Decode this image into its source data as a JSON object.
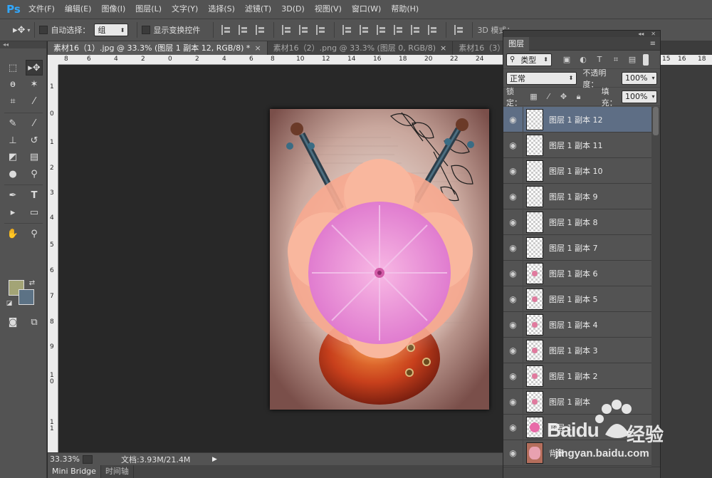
{
  "app": {
    "logo": "Ps"
  },
  "menu": [
    "文件(F)",
    "编辑(E)",
    "图像(I)",
    "图层(L)",
    "文字(Y)",
    "选择(S)",
    "滤镜(T)",
    "3D(D)",
    "视图(V)",
    "窗口(W)",
    "帮助(H)"
  ],
  "options": {
    "auto_select_label": "自动选择：",
    "auto_select_value": "组",
    "show_transform_label": "显示变换控件",
    "mode_3d_label": "3D 模式："
  },
  "tabs": [
    {
      "label": "素材16（1）.jpg @ 33.3% (图层 1 副本 12, RGB/8) *",
      "close": "×",
      "active": true
    },
    {
      "label": "素材16（2）.png @ 33.3% (图层 0, RGB/8)",
      "close": "×",
      "active": false
    },
    {
      "label": "素材16（3）.png @",
      "close": "",
      "active": false
    }
  ],
  "ruler": {
    "top": [
      "8",
      "6",
      "4",
      "2",
      "0",
      "2",
      "4",
      "6",
      "8",
      "10",
      "12",
      "14",
      "16",
      "18",
      "20",
      "22",
      "24",
      "26"
    ],
    "right": [
      "15",
      "16",
      "18"
    ],
    "left": [
      "1",
      "0",
      "1",
      "2",
      "3",
      "4",
      "5",
      "6",
      "7",
      "8",
      "9",
      "1 0",
      "1 1",
      "1 2"
    ]
  },
  "status": {
    "zoom": "33.33%",
    "doc": "文档:3.93M/21.4M"
  },
  "bottom_tabs": [
    "Mini Bridge",
    "时间轴"
  ],
  "layers_panel": {
    "title": "图层",
    "filter_label": "类型",
    "blend_mode": "正常",
    "opacity_label": "不透明度：",
    "opacity_value": "100%",
    "lock_label": "锁定：",
    "fill_label": "填充：",
    "fill_value": "100%",
    "layers": [
      {
        "name": "图层 1 副本 12",
        "selected": true,
        "thumb": "empty"
      },
      {
        "name": "图层 1 副本 11",
        "selected": false,
        "thumb": "empty"
      },
      {
        "name": "图层 1 副本 10",
        "selected": false,
        "thumb": "empty"
      },
      {
        "name": "图层 1 副本 9",
        "selected": false,
        "thumb": "empty"
      },
      {
        "name": "图层 1 副本 8",
        "selected": false,
        "thumb": "empty"
      },
      {
        "name": "图层 1 副本 7",
        "selected": false,
        "thumb": "empty"
      },
      {
        "name": "图层 1 副本 6",
        "selected": false,
        "thumb": "dot"
      },
      {
        "name": "图层 1 副本 5",
        "selected": false,
        "thumb": "dot"
      },
      {
        "name": "图层 1 副本 4",
        "selected": false,
        "thumb": "dot"
      },
      {
        "name": "图层 1 副本 3",
        "selected": false,
        "thumb": "dot"
      },
      {
        "name": "图层 1 副本 2",
        "selected": false,
        "thumb": "dot"
      },
      {
        "name": "图层 1 副本",
        "selected": false,
        "thumb": "dot"
      },
      {
        "name": "图层 1",
        "selected": false,
        "thumb": "flower"
      },
      {
        "name": "背景",
        "selected": false,
        "thumb": "bg"
      }
    ]
  },
  "watermark": {
    "brand": "Baidu",
    "brand_cn": "经验",
    "url": "jingyan.baidu.com"
  },
  "colors": {
    "foreground": "#a3a476",
    "background": "#5c7285",
    "selected_layer": "#5e6e85",
    "panel": "#535353",
    "canvas_bg": "#282828"
  }
}
